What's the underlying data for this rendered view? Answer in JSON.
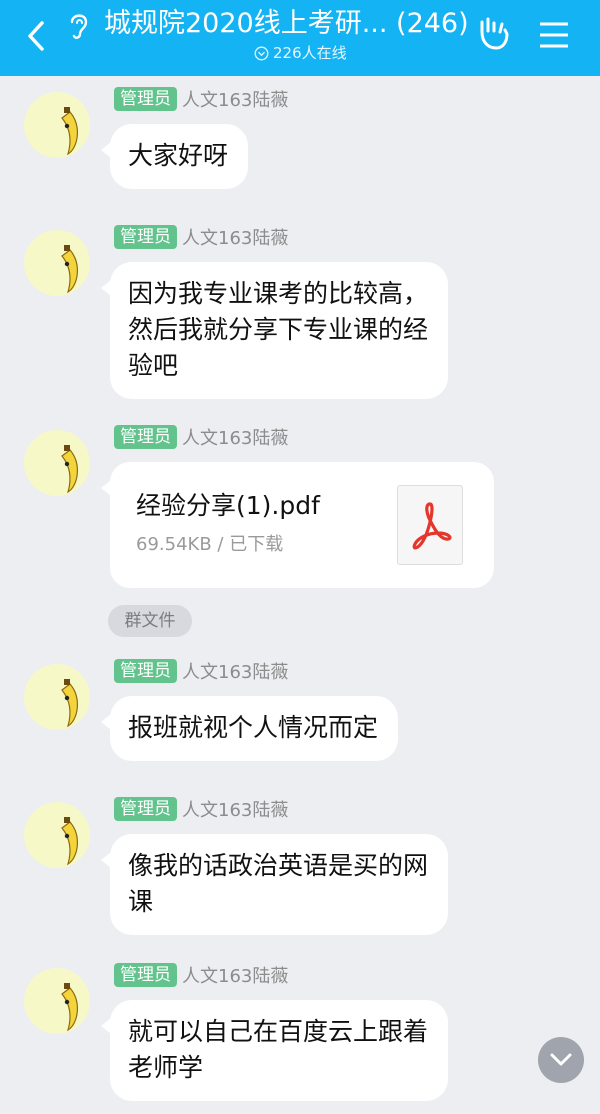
{
  "header": {
    "title": "城规院2020线上考研... (246)",
    "online_text": "226人在线",
    "icons": {
      "back": "chevron-left-icon",
      "listen": "ear-icon",
      "gesture": "hand-icon",
      "menu": "menu-icon",
      "online": "chevron-down-circle-icon"
    },
    "colors": {
      "bar": "#14b3f3"
    }
  },
  "messages": [
    {
      "badge": "管理员",
      "nick": "人文163陆薇",
      "lines": [
        "大家好呀"
      ]
    },
    {
      "badge": "管理员",
      "nick": "人文163陆薇",
      "lines": [
        "因为我专业课考的比较高，",
        "然后我就分享下专业课的经",
        "验吧"
      ]
    },
    {
      "badge": "管理员",
      "nick": "人文163陆薇",
      "file": {
        "name": "经验分享(1).pdf",
        "meta": "69.54KB / 已下载",
        "icon": "pdf-icon"
      }
    },
    {
      "badge": "管理员",
      "nick": "人文163陆薇",
      "lines": [
        "报班就视个人情况而定"
      ]
    },
    {
      "badge": "管理员",
      "nick": "人文163陆薇",
      "lines": [
        "像我的话政治英语是买的网",
        "课"
      ]
    },
    {
      "badge": "管理员",
      "nick": "人文163陆薇",
      "lines": [
        "就可以自己在百度云上跟着",
        "老师学"
      ]
    }
  ],
  "group_file_tag": "群文件",
  "colors": {
    "badge": "#62c48c",
    "background": "#edeef2",
    "pdf_red": "#e5362b"
  }
}
